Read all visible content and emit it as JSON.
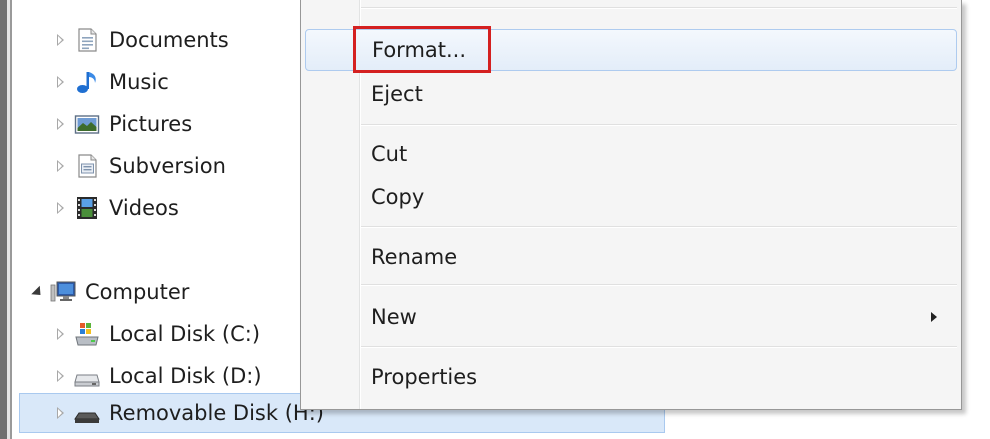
{
  "nav_tree": {
    "items": [
      {
        "label": "Documents",
        "icon": "documents-icon"
      },
      {
        "label": "Music",
        "icon": "music-icon"
      },
      {
        "label": "Pictures",
        "icon": "pictures-icon"
      },
      {
        "label": "Subversion",
        "icon": "subversion-icon"
      },
      {
        "label": "Videos",
        "icon": "videos-icon"
      },
      {
        "label": "Computer",
        "icon": "computer-icon",
        "expanded": true
      },
      {
        "label": "Local Disk (C:)",
        "icon": "system-drive-icon"
      },
      {
        "label": "Local Disk (D:)",
        "icon": "hard-drive-icon"
      },
      {
        "label": "Removable Disk (H:)",
        "icon": "removable-disk-icon",
        "selected": true
      }
    ]
  },
  "context_menu": {
    "items": [
      {
        "label": "Format...",
        "highlighted": true
      },
      {
        "label": "Eject"
      },
      {
        "label": "Cut"
      },
      {
        "label": "Copy"
      },
      {
        "label": "Rename"
      },
      {
        "label": "New",
        "has_submenu": true
      },
      {
        "label": "Properties"
      }
    ]
  },
  "annotation": {
    "color": "#d42020",
    "target": "Format..."
  },
  "colors": {
    "selection": "#d9e8f9",
    "menu_background": "#f5f5f5",
    "menu_hover": "#e3edf9"
  }
}
